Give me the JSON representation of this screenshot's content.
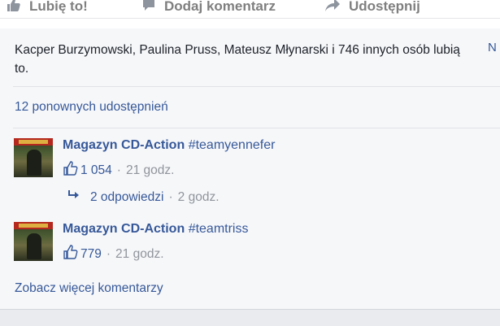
{
  "actions": {
    "like_label": "Lubię to!",
    "comment_label": "Dodaj komentarz",
    "share_label": "Udostępnij"
  },
  "likes": {
    "text": "Kacper Burzymowski, Paulina Pruss, Mateusz Młynarski i 746 innych osób lubią to.",
    "right_edge_letter": "N"
  },
  "shares": {
    "text": "12 ponownych udostępnień"
  },
  "comments": [
    {
      "author": "Magazyn CD-Action",
      "text": "#teamyennefer",
      "like_count": "1 054",
      "time": "21 godz."
    },
    {
      "author": "Magazyn CD-Action",
      "text": "#teamtriss",
      "like_count": "779",
      "time": "21 godz."
    }
  ],
  "reply": {
    "label": "2 odpowiedzi",
    "time": "2 godz."
  },
  "more_comments": "Zobacz więcej komentarzy",
  "icons": {
    "like": "thumbs-up-icon",
    "comment": "speech-bubble-icon",
    "share": "share-arrow-icon",
    "reply": "reply-arrow-icon"
  },
  "colors": {
    "link": "#365899",
    "muted": "#90949c",
    "panel": "#f6f7f9"
  }
}
